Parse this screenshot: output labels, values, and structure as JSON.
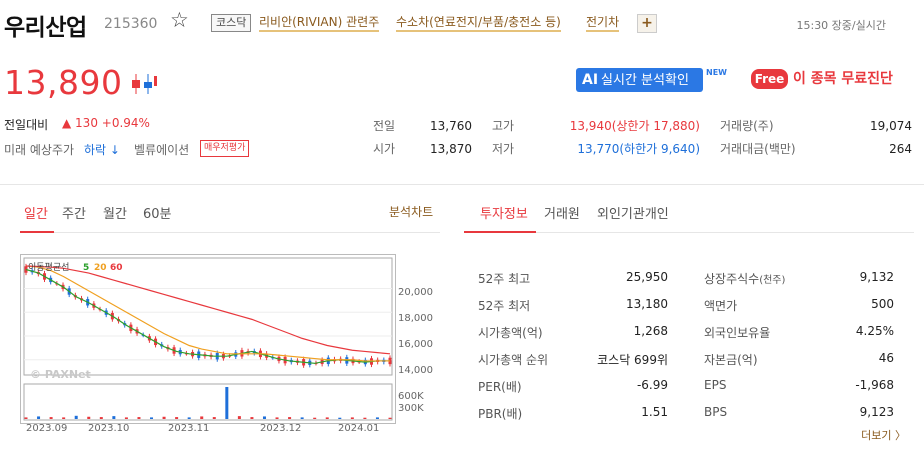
{
  "header": {
    "stock_name": "우리산업",
    "stock_code": "215360",
    "market": "코스닥",
    "themes": [
      "리비안(RIVIAN) 관련주",
      "수소차(연료전지/부품/충전소 등)",
      "전기차"
    ],
    "add_label": "+",
    "timestamp": "15:30 장중/실시간"
  },
  "price": {
    "current": "13,890",
    "change_label": "전일대비",
    "change": "▲ 130 +0.94%",
    "forecast_label": "미래 예상주가",
    "forecast": "하락 ↓",
    "valuation_label": "벨류에이션",
    "valuation_badge": "매우저평가"
  },
  "promo": {
    "ai_prefix": "AI",
    "ai_label": "실시간 분석확인",
    "new_tag": "NEW",
    "free_badge": "Free",
    "free_label": "이 종목 무료진단"
  },
  "quote": {
    "prev_label": "전일",
    "prev": "13,760",
    "open_label": "시가",
    "open": "13,870",
    "high_label": "고가",
    "high": "13,940(상한가 17,880)",
    "low_label": "저가",
    "low": "13,770(하한가 9,640)",
    "volume_label": "거래량(주)",
    "volume": "19,074",
    "amount_label": "거래대금(백만)",
    "amount": "264"
  },
  "chart_tabs": [
    "일간",
    "주간",
    "월간",
    "60분"
  ],
  "chart_link": "분석차트",
  "info_tabs": [
    "투자정보",
    "거래원",
    "외인기관개인"
  ],
  "chart_data": {
    "type": "line",
    "ma_label": "이동평균선",
    "ma_periods": [
      "5",
      "20",
      "60"
    ],
    "watermark": "PAXNet",
    "y_ticks": [
      "20,000",
      "18,000",
      "16,000",
      "14,000"
    ],
    "ylim": [
      12800,
      22400
    ],
    "volume_ticks": [
      "600K",
      "300K"
    ],
    "x_labels": [
      "2023.09",
      "2023.10",
      "2023.11",
      "2023.12",
      "2024.01"
    ],
    "colors": {
      "ma5": "#2ca02c",
      "ma20": "#f0a020",
      "ma60": "#e8383d",
      "up": "#e8383d",
      "down": "#1e6fd9"
    },
    "series": [
      {
        "name": "5",
        "values": [
          21600,
          21300,
          20700,
          20100,
          19300,
          18800,
          18200,
          17600,
          16900,
          16300,
          15700,
          15100,
          14700,
          14500,
          14400,
          14300,
          14300,
          14500,
          14700,
          14400,
          14100,
          13900,
          13800,
          13700,
          13900,
          14000,
          13900,
          13800,
          13900,
          13900
        ]
      },
      {
        "name": "20",
        "values": [
          21900,
          21800,
          21500,
          21000,
          20400,
          19800,
          19200,
          18600,
          18000,
          17400,
          16800,
          16200,
          15700,
          15200,
          14900,
          14700,
          14500,
          14500,
          14500,
          14500,
          14400,
          14300,
          14200,
          14100,
          14000,
          14000,
          14000,
          13900,
          13900,
          13900
        ]
      },
      {
        "name": "60",
        "values": [
          21900,
          21850,
          21800,
          21700,
          21500,
          21300,
          21000,
          20700,
          20400,
          20100,
          19800,
          19500,
          19200,
          18900,
          18600,
          18300,
          18000,
          17700,
          17400,
          17000,
          16600,
          16200,
          15800,
          15500,
          15200,
          15000,
          14800,
          14700,
          14600,
          14500
        ]
      }
    ],
    "volume": [
      0.05,
      0.08,
      0.06,
      0.05,
      0.1,
      0.07,
      0.06,
      0.09,
      0.05,
      0.06,
      0.05,
      0.07,
      0.06,
      0.05,
      0.08,
      0.06,
      1.0,
      0.09,
      0.06,
      0.08,
      0.05,
      0.06,
      0.05,
      0.04,
      0.05,
      0.04,
      0.05,
      0.04,
      0.05,
      0.04
    ]
  },
  "info": {
    "left": [
      {
        "label": "52주 최고",
        "value": "25,950"
      },
      {
        "label": "52주 최저",
        "value": "13,180"
      },
      {
        "label": "시가총액(억)",
        "value": "1,268"
      },
      {
        "label": "시가총액 순위",
        "value": "코스닥 699위"
      },
      {
        "label": "PER(배)",
        "value": "-6.99"
      },
      {
        "label": "PBR(배)",
        "value": "1.51"
      }
    ],
    "right": [
      {
        "label": "상장주식수",
        "label_sub": "(천주)",
        "value": "9,132"
      },
      {
        "label": "액면가",
        "label_sub": "",
        "value": "500"
      },
      {
        "label": "외국인보유율",
        "label_sub": "",
        "value": "4.25%"
      },
      {
        "label": "자본금(억)",
        "label_sub": "",
        "value": "46"
      },
      {
        "label": "EPS",
        "label_sub": "",
        "value": "-1,968"
      },
      {
        "label": "BPS",
        "label_sub": "",
        "value": "9,123"
      }
    ],
    "more_label": "더보기 〉"
  }
}
